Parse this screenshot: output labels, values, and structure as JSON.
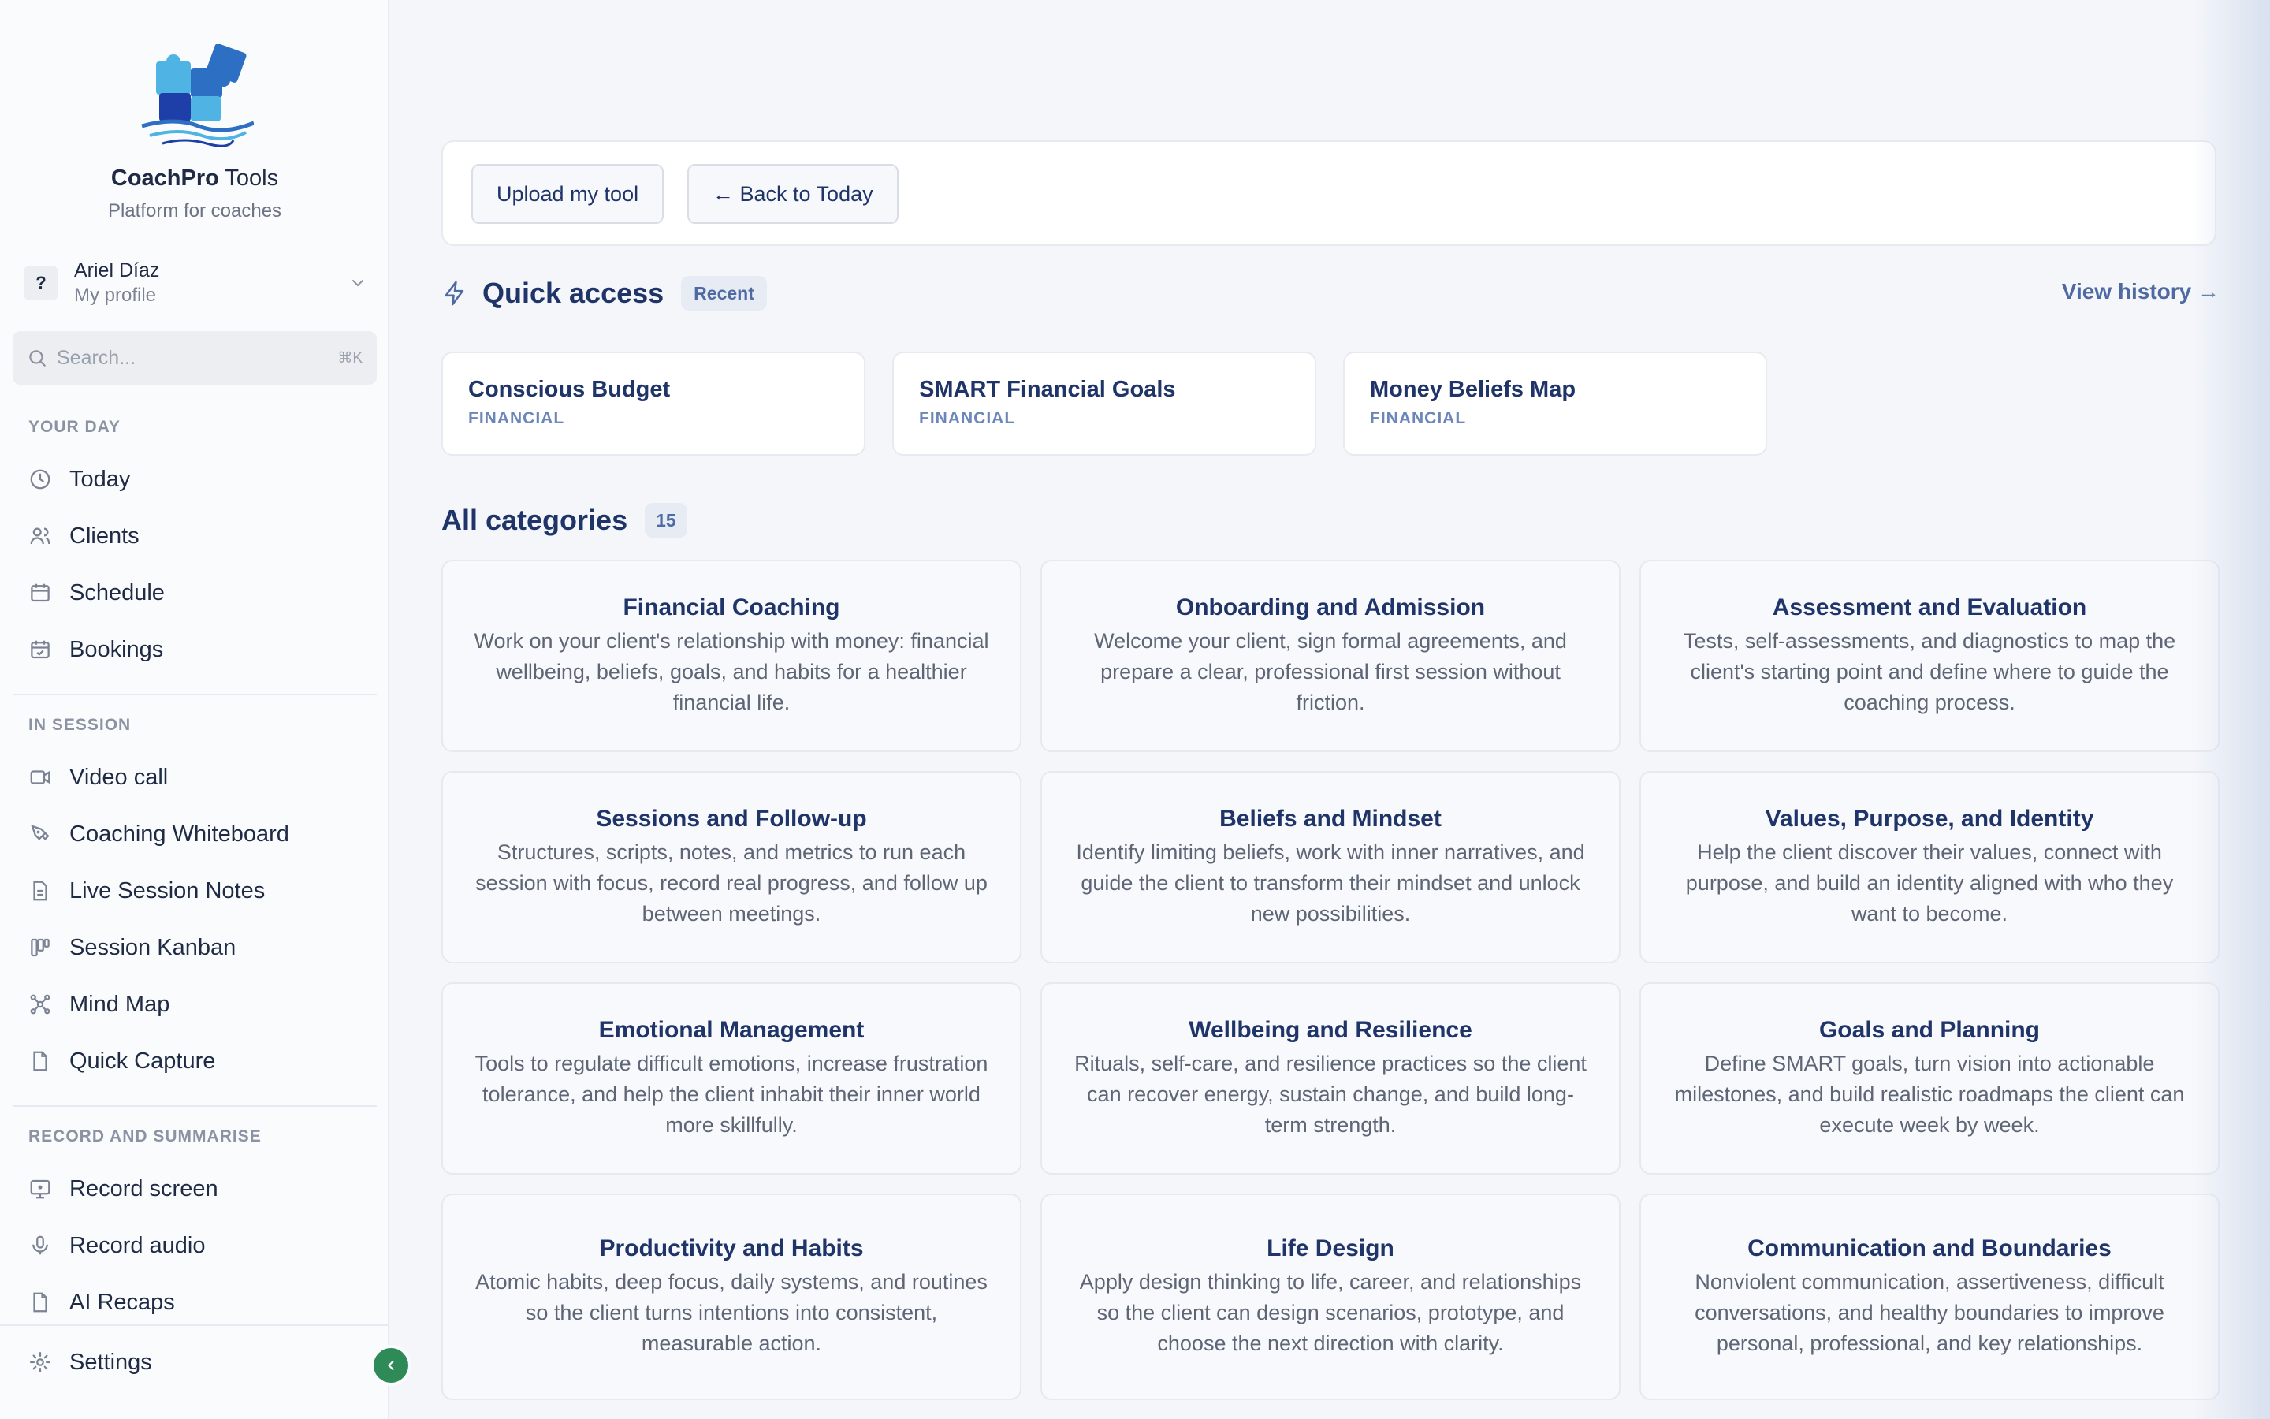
{
  "brand": {
    "name_bold": "CoachPro",
    "name_rest": " Tools",
    "tagline": "Platform for coaches"
  },
  "profile": {
    "initial": "?",
    "name": "Ariel Díaz",
    "subtitle": "My profile"
  },
  "search": {
    "placeholder": "Search...",
    "shortcut": "⌘K"
  },
  "nav": {
    "your_day": {
      "heading": "YOUR DAY",
      "items": [
        {
          "label": "Today",
          "icon": "clock-icon"
        },
        {
          "label": "Clients",
          "icon": "users-icon"
        },
        {
          "label": "Schedule",
          "icon": "calendar-icon"
        },
        {
          "label": "Bookings",
          "icon": "calendar-check-icon"
        }
      ]
    },
    "in_session": {
      "heading": "IN SESSION",
      "items": [
        {
          "label": "Video call",
          "icon": "video-icon"
        },
        {
          "label": "Coaching Whiteboard",
          "icon": "pen-tool-icon"
        },
        {
          "label": "Live Session Notes",
          "icon": "file-text-icon"
        },
        {
          "label": "Session Kanban",
          "icon": "kanban-icon"
        },
        {
          "label": "Mind Map",
          "icon": "network-icon"
        },
        {
          "label": "Quick Capture",
          "icon": "file-icon"
        }
      ]
    },
    "record": {
      "heading": "RECORD AND SUMMARISE",
      "items": [
        {
          "label": "Record screen",
          "icon": "monitor-record-icon"
        },
        {
          "label": "Record audio",
          "icon": "mic-icon"
        },
        {
          "label": "AI Recaps",
          "icon": "file-icon"
        }
      ]
    },
    "settings": {
      "label": "Settings",
      "icon": "gear-icon"
    }
  },
  "toolbar": {
    "upload_label": "Upload my tool",
    "back_label": "← Back to Today"
  },
  "quick_access": {
    "title": "Quick access",
    "badge": "Recent",
    "view_history": "View history →",
    "cards": [
      {
        "title": "Conscious Budget",
        "tag": "FINANCIAL"
      },
      {
        "title": "SMART Financial Goals",
        "tag": "FINANCIAL"
      },
      {
        "title": "Money Beliefs Map",
        "tag": "FINANCIAL"
      }
    ]
  },
  "categories": {
    "title": "All categories",
    "count": "15",
    "items": [
      {
        "title": "Financial Coaching",
        "desc": "Work on your client's relationship with money: financial wellbeing, beliefs, goals, and habits for a healthier financial life."
      },
      {
        "title": "Onboarding and Admission",
        "desc": "Welcome your client, sign formal agreements, and prepare a clear, professional first session without friction."
      },
      {
        "title": "Assessment and Evaluation",
        "desc": "Tests, self-assessments, and diagnostics to map the client's starting point and define where to guide the coaching process."
      },
      {
        "title": "Sessions and Follow-up",
        "desc": "Structures, scripts, notes, and metrics to run each session with focus, record real progress, and follow up between meetings."
      },
      {
        "title": "Beliefs and Mindset",
        "desc": "Identify limiting beliefs, work with inner narratives, and guide the client to transform their mindset and unlock new possibilities."
      },
      {
        "title": "Values, Purpose, and Identity",
        "desc": "Help the client discover their values, connect with purpose, and build an identity aligned with who they want to become."
      },
      {
        "title": "Emotional Management",
        "desc": "Tools to regulate difficult emotions, increase frustration tolerance, and help the client inhabit their inner world more skillfully."
      },
      {
        "title": "Wellbeing and Resilience",
        "desc": "Rituals, self-care, and resilience practices so the client can recover energy, sustain change, and build long-term strength."
      },
      {
        "title": "Goals and Planning",
        "desc": "Define SMART goals, turn vision into actionable milestones, and build realistic roadmaps the client can execute week by week."
      },
      {
        "title": "Productivity and Habits",
        "desc": "Atomic habits, deep focus, daily systems, and routines so the client turns intentions into consistent, measurable action."
      },
      {
        "title": "Life Design",
        "desc": "Apply design thinking to life, career, and relationships so the client can design scenarios, prototype, and choose the next direction with clarity."
      },
      {
        "title": "Communication and Boundaries",
        "desc": "Nonviolent communication, assertiveness, difficult conversations, and healthy boundaries to improve personal, professional, and key relationships."
      }
    ]
  },
  "colors": {
    "accent": "#1f3468",
    "muted_accent": "#4f6aa3",
    "collapse_button": "#2e8b57"
  }
}
